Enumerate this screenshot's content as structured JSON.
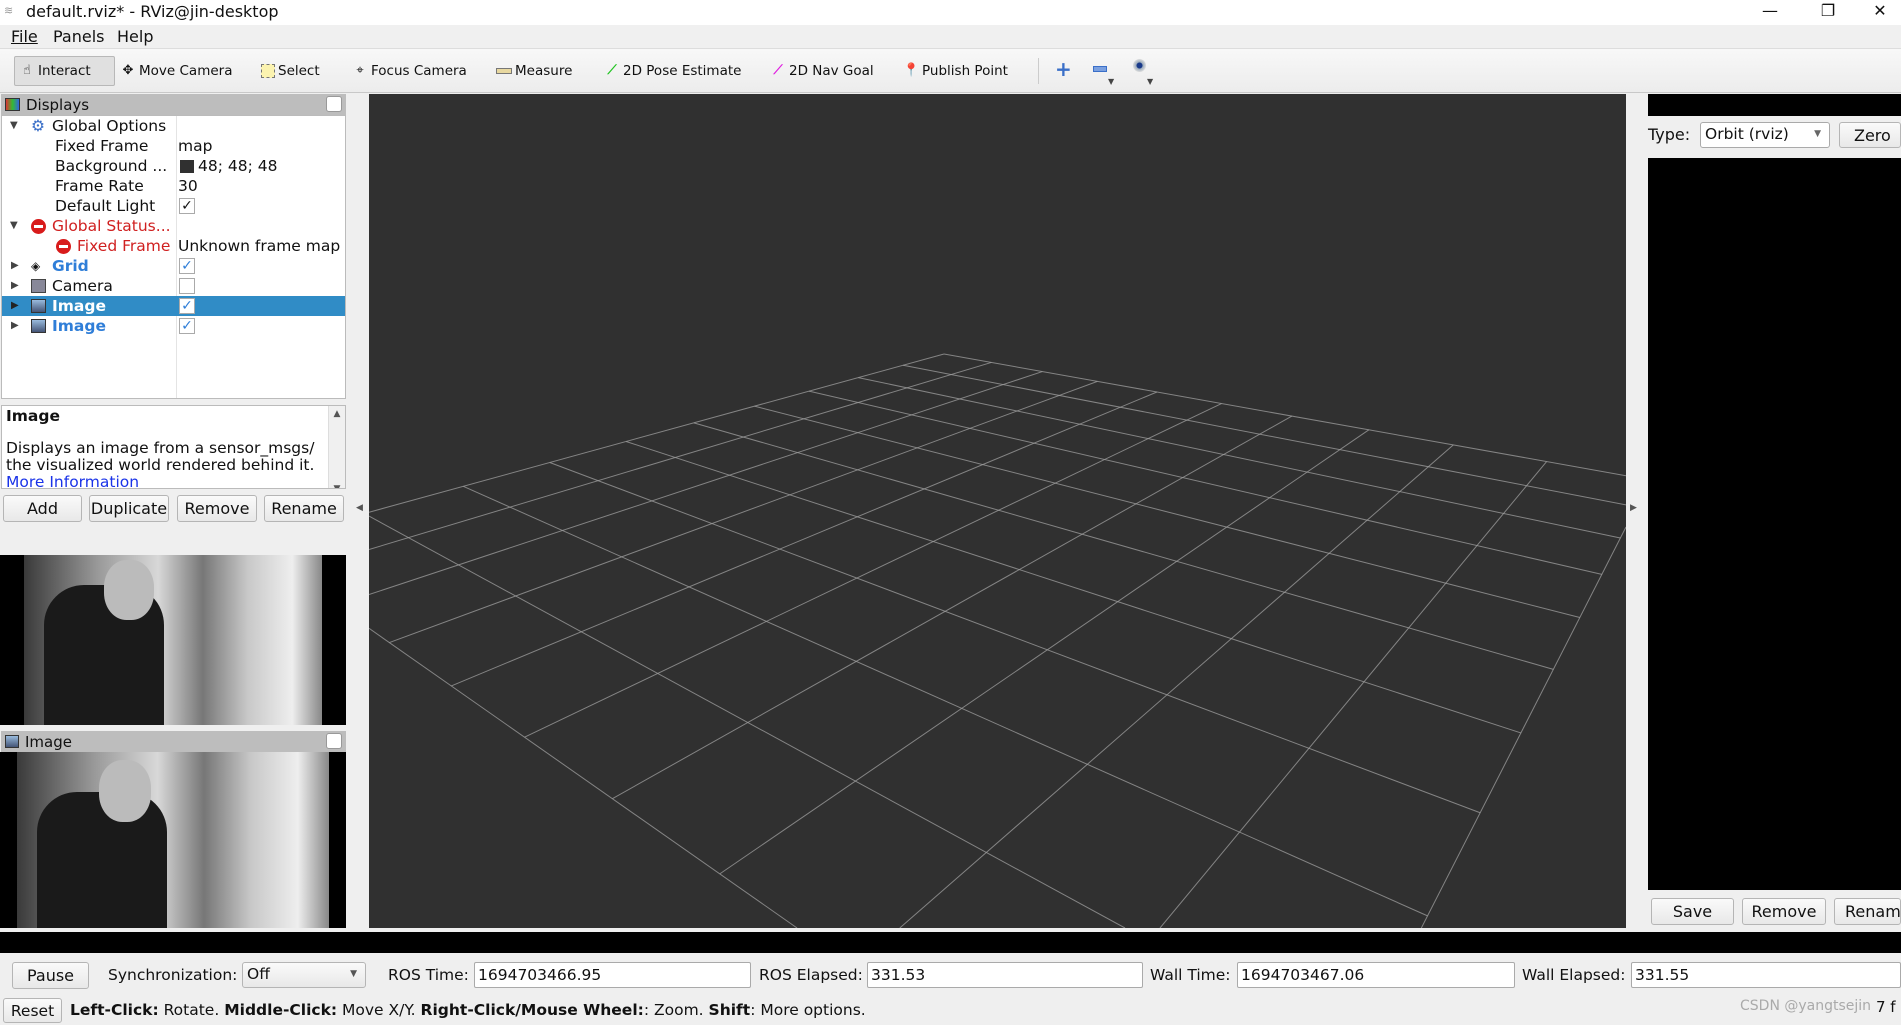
{
  "window": {
    "title": "default.rviz* - RViz@jin-desktop",
    "minimize": "—",
    "maximize": "❐",
    "close": "✕"
  },
  "menu": [
    "File",
    "Panels",
    "Help"
  ],
  "toolbar": {
    "tools": [
      {
        "label": "Interact",
        "icon": "hand-icon"
      },
      {
        "label": "Move Camera",
        "icon": "move-camera-icon"
      },
      {
        "label": "Select",
        "icon": "select-icon"
      },
      {
        "label": "Focus Camera",
        "icon": "focus-camera-icon"
      },
      {
        "label": "Measure",
        "icon": "ruler-icon"
      },
      {
        "label": "2D Pose Estimate",
        "icon": "green-arrow-icon"
      },
      {
        "label": "2D Nav Goal",
        "icon": "magenta-arrow-icon"
      },
      {
        "label": "Publish Point",
        "icon": "map-pin-icon"
      }
    ],
    "active": "Interact",
    "colors": {
      "pose": "#22c422",
      "nav": "#e020e0",
      "pin": "#c0502a"
    }
  },
  "displays": {
    "title": "Displays",
    "rows": [
      {
        "label": "Global Options",
        "value": ""
      },
      {
        "label": "Fixed Frame",
        "value": "map"
      },
      {
        "label": "Background ...",
        "value": "48; 48; 48",
        "color": "#303030"
      },
      {
        "label": "Frame Rate",
        "value": "30"
      },
      {
        "label": "Default Light",
        "checked": true
      },
      {
        "label": "Global Status...",
        "value": ""
      },
      {
        "label": "Fixed Frame",
        "value": "Unknown frame map"
      },
      {
        "label": "Grid",
        "checked": true
      },
      {
        "label": "Camera",
        "checked": false
      },
      {
        "label": "Image",
        "checked": true,
        "selected": true
      },
      {
        "label": "Image",
        "checked": true
      }
    ],
    "description": {
      "title": "Image",
      "line1": "Displays an image from a sensor_msgs/",
      "line2": "the visualized world rendered behind it.",
      "link": "More Information"
    },
    "buttons": [
      "Add",
      "Duplicate",
      "Remove",
      "Rename"
    ]
  },
  "image_panel": {
    "title": "Image"
  },
  "views": {
    "type_label": "Type:",
    "type_value": "Orbit (rviz)",
    "zero": "Zero",
    "buttons": [
      "Save",
      "Remove",
      "Rename"
    ]
  },
  "time": {
    "pause": "Pause",
    "sync_label": "Synchronization:",
    "sync_value": "Off",
    "ros_time_label": "ROS Time:",
    "ros_time": "1694703466.95",
    "ros_elapsed_label": "ROS Elapsed:",
    "ros_elapsed": "331.53",
    "wall_time_label": "Wall Time:",
    "wall_time": "1694703467.06",
    "wall_elapsed_label": "Wall Elapsed:",
    "wall_elapsed": "331.55"
  },
  "status": {
    "reset": "Reset",
    "parts": [
      {
        "b": "Left-Click:",
        "t": " Rotate. "
      },
      {
        "b": "Middle-Click:",
        "t": " Move X/Y. "
      },
      {
        "b": "Right-Click/Mouse Wheel:",
        "t": ": Zoom. "
      },
      {
        "b": "Shift",
        "t": ": More options."
      }
    ],
    "watermark": "CSDN @yangtsejin",
    "fps": "7 f"
  },
  "grid": {
    "cells": 10,
    "background": "#303030",
    "line_color": "#a0a0a0"
  }
}
